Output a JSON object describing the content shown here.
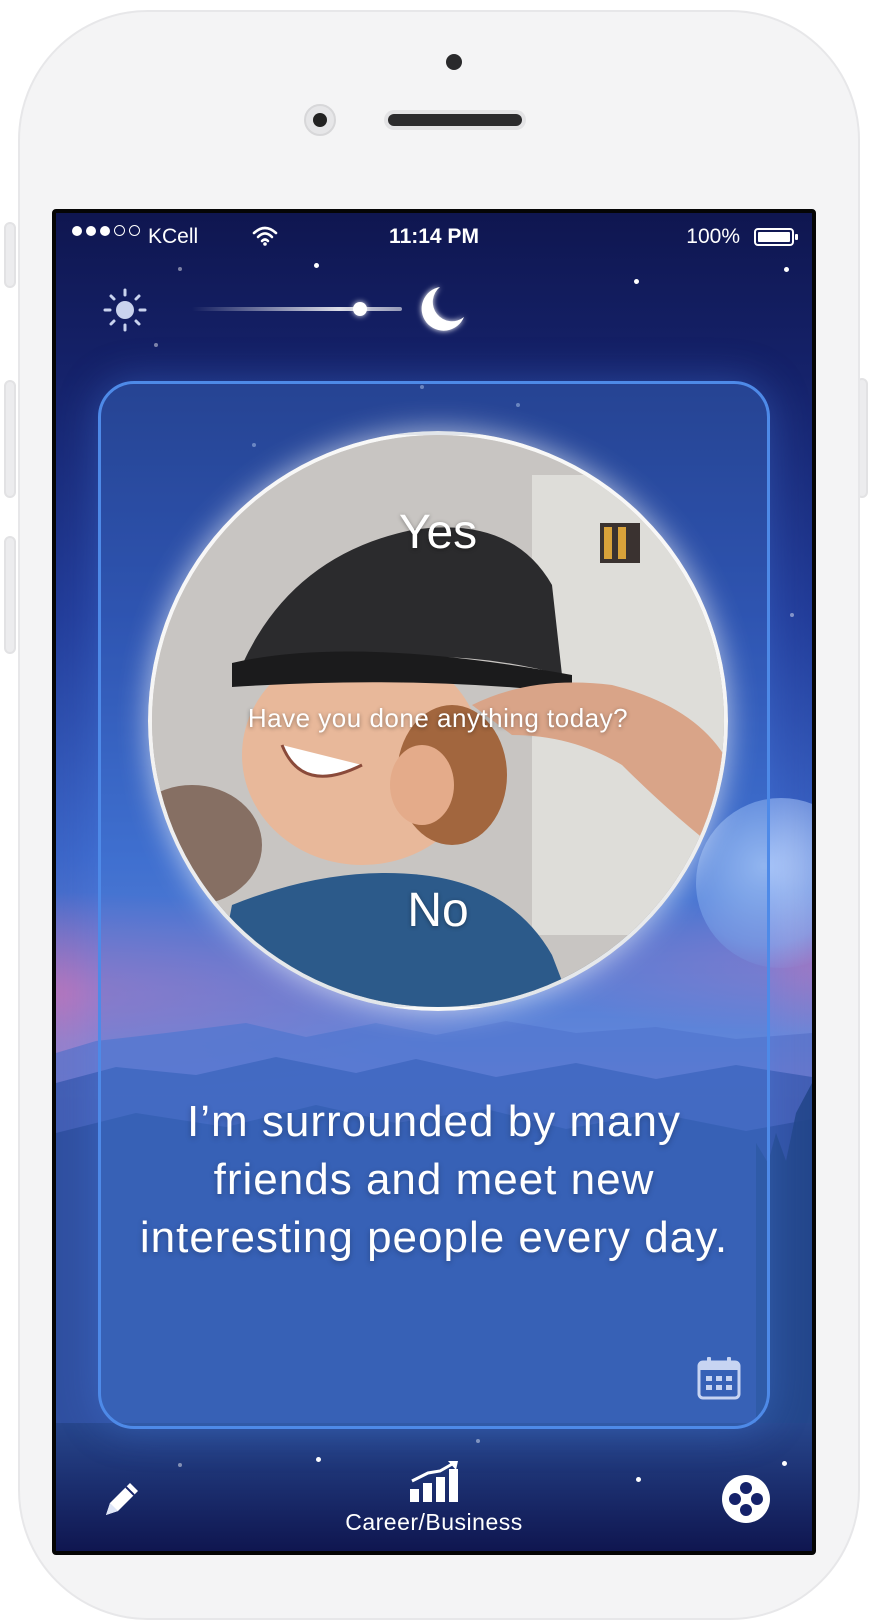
{
  "status_bar": {
    "carrier": "KCell",
    "time": "11:14 PM",
    "battery": "100%",
    "signal_icon": "signal-dots-icon",
    "wifi_icon": "wifi-icon",
    "battery_icon": "battery-icon"
  },
  "theme_toggle": {
    "left_icon": "sun-icon",
    "right_icon": "moon-icon",
    "level": 0.8
  },
  "card": {
    "swipe_up_icon": "chevron-up-icon",
    "yes_label": "Yes",
    "question": "Have you done anything today?",
    "no_label": "No",
    "swipe_down_icon": "chevron-down-icon",
    "affirmation": "I’m surrounded by many friends  and meet new interesting people every day.",
    "calendar_icon": "calendar-icon"
  },
  "bottom_bar": {
    "edit_icon": "pencil-icon",
    "category_icon": "bar-chart-growth-icon",
    "category_label": "Career/Business",
    "menu_icon": "menu-circle-icon"
  },
  "colors": {
    "night_sky": "#0f1650",
    "card_border": "#4e8ae8",
    "text": "#ffffff"
  }
}
